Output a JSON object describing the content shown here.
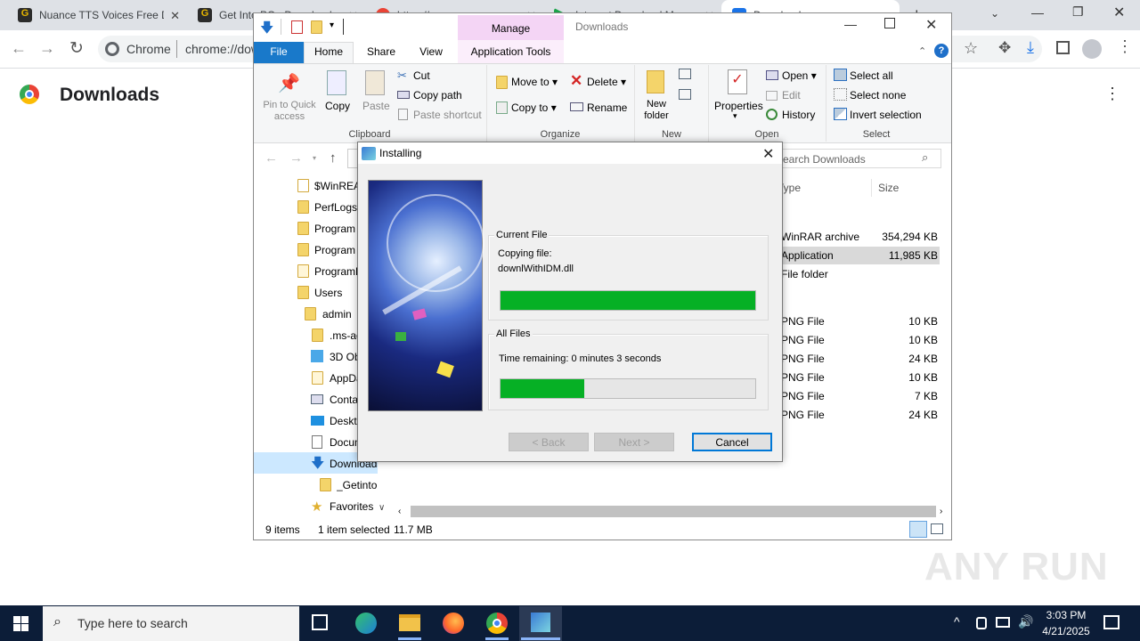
{
  "browser": {
    "tabs": [
      {
        "title": "Nuance TTS Voices Free D"
      },
      {
        "title": "Get Into PC - Download"
      },
      {
        "title": "https://..."
      },
      {
        "title": "Internet Download Manager"
      },
      {
        "title": "Downloads"
      }
    ],
    "omnibox": {
      "site_label": "Chrome",
      "url": "chrome://downloads"
    },
    "page_title": "Downloads"
  },
  "explorer": {
    "title": "Downloads",
    "contextual_tab": "Manage",
    "ribbon_tabs": [
      "File",
      "Home",
      "Share",
      "View",
      "Application Tools"
    ],
    "clipboard": {
      "pin": "Pin to Quick access",
      "copy": "Copy",
      "paste": "Paste",
      "cut": "Cut",
      "copy_path": "Copy path",
      "paste_shortcut": "Paste shortcut",
      "group": "Clipboard"
    },
    "organize": {
      "move_to": "Move to",
      "copy_to": "Copy to",
      "delete": "Delete",
      "rename": "Rename",
      "group": "Organize"
    },
    "new": {
      "new_folder": "New folder",
      "group": "New"
    },
    "open": {
      "properties": "Properties",
      "open": "Open",
      "edit": "Edit",
      "history": "History",
      "group": "Open"
    },
    "select": {
      "all": "Select all",
      "none": "Select none",
      "invert": "Invert selection",
      "group": "Select"
    },
    "search_placeholder": "Search Downloads",
    "columns": {
      "type": "Type",
      "size": "Size"
    },
    "nav_items": [
      "$WinREAgent",
      "PerfLogs",
      "Program Files",
      "Program Files (x86)",
      "ProgramData",
      "Users",
      "admin",
      ".ms-ad",
      "3D Objects",
      "AppData",
      "Contacts",
      "Desktop",
      "Documents",
      "Downloads",
      "_Getintopc",
      "Favorites"
    ],
    "rows": [
      {
        "type": "WinRAR archive",
        "size": "354,294 KB"
      },
      {
        "type": "Application",
        "size": "11,985 KB"
      },
      {
        "type": "File folder",
        "size": ""
      },
      {
        "type": "PNG File",
        "size": "10 KB"
      },
      {
        "type": "PNG File",
        "size": "10 KB"
      },
      {
        "type": "PNG File",
        "size": "24 KB"
      },
      {
        "type": "PNG File",
        "size": "10 KB"
      },
      {
        "type": "PNG File",
        "size": "7 KB"
      },
      {
        "type": "PNG File",
        "size": "24 KB"
      }
    ],
    "status": {
      "items": "9 items",
      "selected": "1 item selected",
      "size": "11.7 MB"
    }
  },
  "installer": {
    "title": "Installing",
    "current_file_label": "Current File",
    "copying_label": "Copying file:",
    "file_name": "downlWithIDM.dll",
    "current_progress": 1.0,
    "all_files_label": "All Files",
    "time_remaining": "Time remaining: 0 minutes 3 seconds",
    "all_progress": 0.33,
    "back": "< Back",
    "next": "Next >",
    "cancel": "Cancel"
  },
  "taskbar": {
    "search_placeholder": "Type here to search",
    "time": "3:03 PM",
    "date": "4/21/2025"
  },
  "watermark": "ANY RUN",
  "colors": {
    "progress": "#06b025",
    "taskbar": "#0c1d38",
    "ribbon_file": "#1979ca",
    "manage_tab": "#f4d5f5"
  }
}
